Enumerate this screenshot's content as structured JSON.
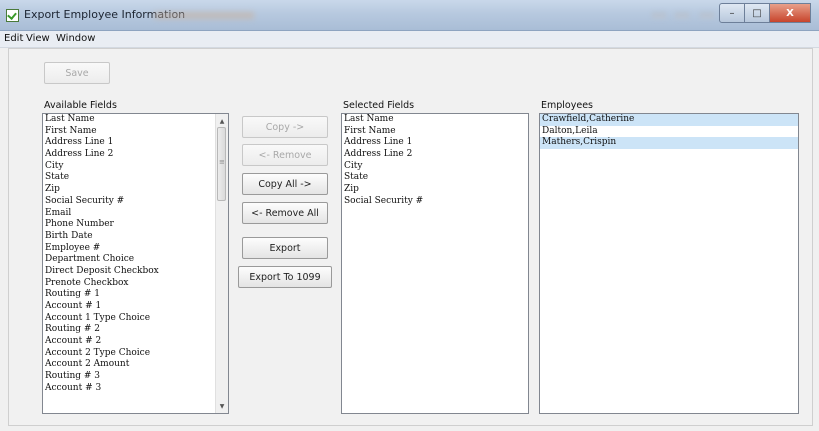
{
  "window": {
    "title": "Export Employee Information",
    "controls": {
      "minimize": "–",
      "maximize": "□",
      "close": "X"
    }
  },
  "menu": {
    "items": [
      "Edit",
      "View",
      "Window"
    ]
  },
  "toolbar": {
    "save_label": "Save"
  },
  "available": {
    "label": "Available Fields",
    "items": [
      "Last Name",
      "First Name",
      "Address Line 1",
      "Address Line 2",
      "City",
      "State",
      "Zip",
      "Social Security #",
      "Email",
      "Phone Number",
      "Birth Date",
      "Employee #",
      "Department Choice",
      "Direct Deposit Checkbox",
      "Prenote Checkbox",
      "Routing # 1",
      "Account # 1",
      "Account 1 Type Choice",
      "Routing # 2",
      "Account # 2",
      "Account 2 Type Choice",
      "Account 2 Amount",
      "Routing # 3",
      "Account # 3"
    ]
  },
  "actions": {
    "copy": "Copy ->",
    "remove": "<- Remove",
    "copy_all": "Copy All ->",
    "remove_all": "<- Remove All",
    "export": "Export",
    "export_1099": "Export To 1099"
  },
  "selected": {
    "label": "Selected Fields",
    "items": [
      "Last Name",
      "First Name",
      "Address Line 1",
      "Address Line 2",
      "City",
      "State",
      "Zip",
      "Social Security #"
    ]
  },
  "employees": {
    "label": "Employees",
    "items": [
      {
        "name": "Crawfield,Catherine",
        "selected": true
      },
      {
        "name": "Dalton,Leila",
        "selected": false
      },
      {
        "name": "Mathers,Crispin",
        "selected": true
      }
    ]
  },
  "icons": {
    "app": "checkmark-app-icon",
    "scroll_up": "chevron-up-icon",
    "scroll_down": "chevron-down-icon",
    "scroll_grip": "grip-icon"
  },
  "colors": {
    "titlebar": "#b7c9df",
    "selection": "#cce4f7",
    "close_button": "#c7442c",
    "disabled_text": "#a8a8a8"
  }
}
